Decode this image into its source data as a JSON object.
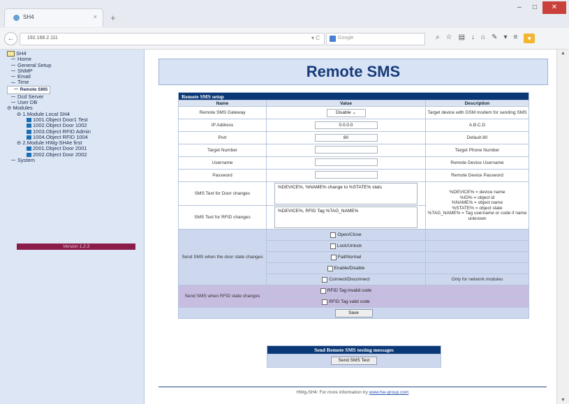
{
  "browser": {
    "tab_title": "SH4",
    "tab_close": "×",
    "new_tab": "+",
    "url": "192.168.2.111",
    "search_placeholder": "Google"
  },
  "sidebar": {
    "tree": [
      {
        "label": "SH4",
        "level": 0,
        "icon": "folder"
      },
      {
        "label": "Home",
        "level": 1
      },
      {
        "label": "General Setup",
        "level": 1
      },
      {
        "label": "SNMP",
        "level": 1
      },
      {
        "label": "Email",
        "level": 1
      },
      {
        "label": "Time",
        "level": 1
      },
      {
        "label": "Remote SMS",
        "level": 1,
        "selected": true
      },
      {
        "label": "Dcd Server",
        "level": 1
      },
      {
        "label": "User DB",
        "level": 1
      },
      {
        "label": "Modules",
        "level": 0
      },
      {
        "label": "1.Module Local SH4",
        "level": 2
      },
      {
        "label": "1001.Object Door1 Test",
        "level": 3,
        "icon": "file"
      },
      {
        "label": "1002.Object Door 1002",
        "level": 3,
        "icon": "file"
      },
      {
        "label": "1003.Object RFID Admin",
        "level": 3,
        "icon": "file"
      },
      {
        "label": "1004.Object RFID 1004",
        "level": 3,
        "icon": "file"
      },
      {
        "label": "2.Module HWg-SH4e first",
        "level": 2
      },
      {
        "label": "2001.Object Door 2001",
        "level": 3,
        "icon": "file"
      },
      {
        "label": "2002.Object Door 2002",
        "level": 3,
        "icon": "file"
      },
      {
        "label": "System",
        "level": 1
      }
    ],
    "version": "Version 1.2.3"
  },
  "main": {
    "title": "Remote SMS",
    "setup": {
      "caption": "Remote SMS setup",
      "headers": {
        "name": "Name",
        "value": "Value",
        "description": "Description"
      },
      "gateway": {
        "label": "Remote SMS Gateway",
        "value": "Disable",
        "description": "Target device with GSM modem for sending SMS"
      },
      "ip": {
        "label": "IP Address",
        "value": "0.0.0.0",
        "description": "A.B.C.D"
      },
      "port": {
        "label": "Port",
        "value": "80",
        "description": "Default 80"
      },
      "target": {
        "label": "Target Number",
        "value": "",
        "description": "Target Phone Number"
      },
      "username": {
        "label": "Username",
        "value": "",
        "description": "Remote Device Username"
      },
      "password": {
        "label": "Password",
        "value": "",
        "description": "Remote Device Password"
      },
      "door_text": {
        "label": "SMS Text for Door changes",
        "value": "%DEVICE%, %NAME% change to %STATE% stats"
      },
      "rfid_text": {
        "label": "SMS Text for RFID changes",
        "value": "%DEVICE%, RFID Tag %TAG_NAME%"
      },
      "text_help": "%DEVICE% = device name\n%ID% = object id\n%NAME% = object name\n%STATE% = object state\n%TAG_NAME% = Tag username or code if name unknown",
      "door_group_label": "Send SMS when the door state changes",
      "door_options": [
        "Open/Close",
        "Lock/Unlock",
        "Fail/Normal",
        "Enable/Disable",
        "Connect/Disconnect"
      ],
      "connect_note": "Only for network modules",
      "rfid_group_label": "Send SMS when RFID state changes",
      "rfid_options": [
        "RFID Tag invalid code",
        "RFID Tag valid code"
      ],
      "save_label": "Save"
    },
    "test": {
      "caption": "Send Remote SMS testing messages",
      "button": "Send SMS Test"
    },
    "footer": {
      "text": "HWg-SH4: For more information try ",
      "link": "www.hw-group.com"
    }
  }
}
